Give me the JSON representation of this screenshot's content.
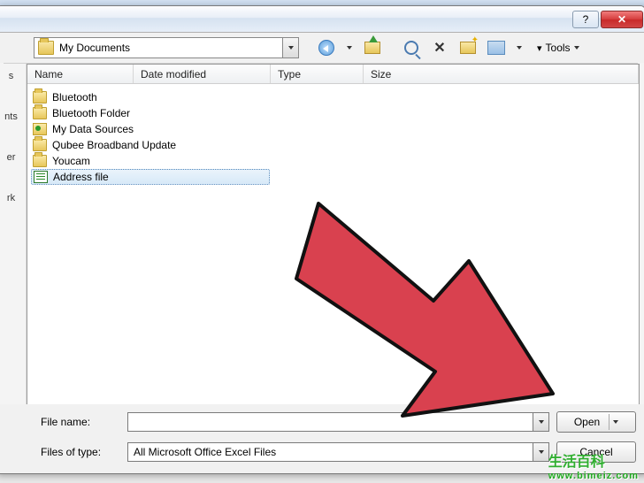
{
  "toolbar": {
    "location_label": "My Documents",
    "tools_label": "Tools"
  },
  "columns": {
    "name": "Name",
    "date": "Date modified",
    "type": "Type",
    "size": "Size"
  },
  "files": [
    {
      "icon": "folder",
      "label": "Bluetooth"
    },
    {
      "icon": "folder",
      "label": "Bluetooth Folder"
    },
    {
      "icon": "odc",
      "label": "My Data Sources"
    },
    {
      "icon": "folder",
      "label": "Qubee Broadband Update"
    },
    {
      "icon": "folder",
      "label": "Youcam"
    },
    {
      "icon": "xls",
      "label": "Address file",
      "selected": true
    }
  ],
  "places": [
    "s",
    "nts",
    "er",
    "rk"
  ],
  "bottom": {
    "filename_label": "File name:",
    "filename_value": "",
    "filetype_label": "Files of type:",
    "filetype_value": "All Microsoft Office Excel Files",
    "open_label": "Open",
    "cancel_label": "Cancel"
  },
  "watermark": {
    "big": "生活百科",
    "url": "www.bimeiz.com"
  }
}
